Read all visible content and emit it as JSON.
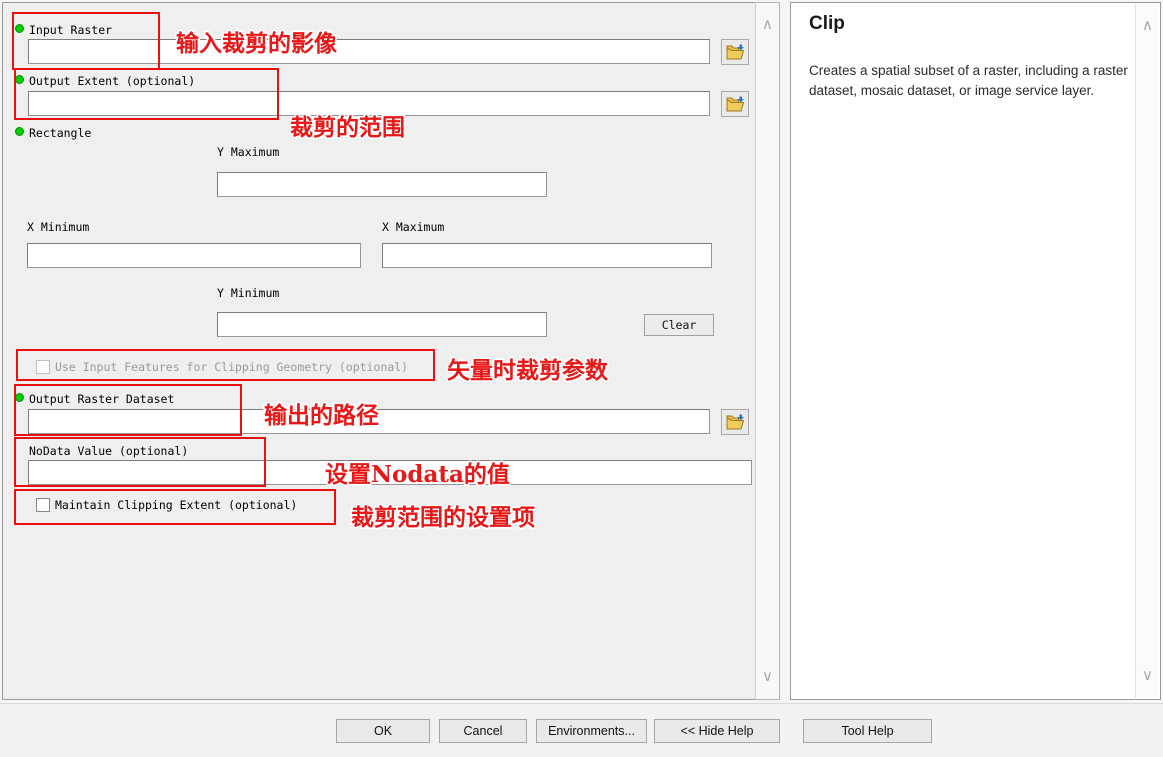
{
  "dialog": {
    "title": "Clip"
  },
  "help": {
    "title": "Clip",
    "description": "Creates a spatial subset of a raster, including a raster dataset, mosaic dataset, or image service layer.",
    "scroll_up_icon": "chevron-up-icon",
    "scroll_down_icon": "chevron-down-icon"
  },
  "params": {
    "input_raster": {
      "label": "Input Raster",
      "value": "",
      "required_marker": "green-dot",
      "browse_icon": "open-folder-icon"
    },
    "output_extent": {
      "label": "Output Extent (optional)",
      "value": "",
      "required_marker": "green-dot",
      "browse_icon": "open-folder-icon"
    },
    "rectangle": {
      "label": "Rectangle",
      "required_marker": "green-dot",
      "y_maximum_label": "Y Maximum",
      "y_maximum_value": "",
      "x_minimum_label": "X Minimum",
      "x_minimum_value": "",
      "x_maximum_label": "X Maximum",
      "x_maximum_value": "",
      "y_minimum_label": "Y Minimum",
      "y_minimum_value": "",
      "clear_button": "Clear"
    },
    "use_input_features": {
      "label": "Use Input Features for Clipping Geometry (optional)",
      "checked": false,
      "enabled": false
    },
    "output_raster_dataset": {
      "label": "Output Raster Dataset",
      "value": "",
      "required_marker": "green-dot",
      "browse_icon": "open-folder-icon"
    },
    "nodata_value": {
      "label": "NoData Value (optional)",
      "value": ""
    },
    "maintain_clipping_extent": {
      "label": "Maintain Clipping Extent (optional)",
      "checked": false,
      "enabled": true
    }
  },
  "scrollbar": {
    "up_icon": "chevron-up-icon",
    "down_icon": "chevron-down-icon"
  },
  "buttons": {
    "ok": "OK",
    "cancel": "Cancel",
    "environments": "Environments...",
    "hide_help": "<< Hide Help",
    "tool_help": "Tool Help"
  },
  "annotations": {
    "accent_color": "#e81818",
    "notes": [
      {
        "text": "输入裁剪的影像"
      },
      {
        "text": "裁剪的范围"
      },
      {
        "text": "矢量时裁剪参数"
      },
      {
        "text": "输出的路径"
      },
      {
        "text": "设置Nodata的值"
      },
      {
        "text": "裁剪范围的设置项"
      }
    ]
  }
}
